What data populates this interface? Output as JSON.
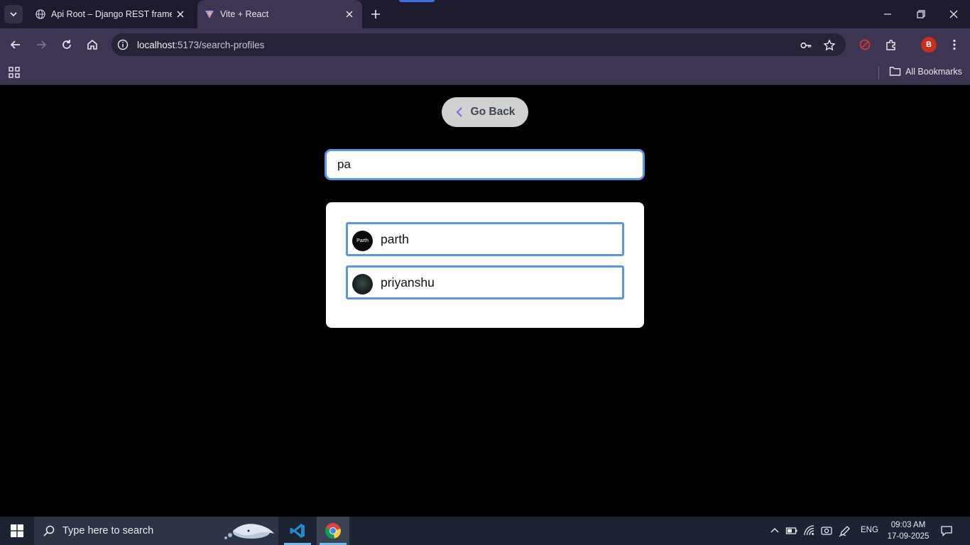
{
  "browser": {
    "tabs": [
      {
        "title": "Api Root – Django REST framew",
        "active": false
      },
      {
        "title": "Vite + React",
        "active": true
      }
    ],
    "url_host": "localhost",
    "url_path": ":5173/search-profiles",
    "bookmarks_label": "All Bookmarks",
    "profile_initial": "B"
  },
  "page": {
    "go_back_label": "Go Back",
    "search_value": "pa",
    "results": [
      {
        "name": "parth",
        "avatar_text": "Parth"
      },
      {
        "name": "priyanshu",
        "avatar_text": ""
      }
    ]
  },
  "taskbar": {
    "search_placeholder": "Type here to search",
    "language": "ENG",
    "time": "09:03 AM",
    "date": "17-09-2025"
  },
  "colors": {
    "accent_border": "#5b95e6",
    "tab_bar": "#1f1b2e",
    "toolbar": "#3d3551",
    "go_back_bg": "#d1d1d1",
    "chevron": "#8b5cf6"
  }
}
